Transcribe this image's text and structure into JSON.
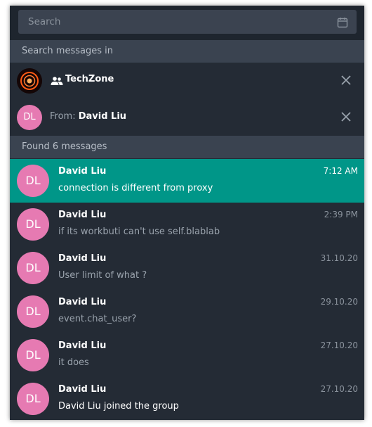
{
  "search": {
    "placeholder": "Search"
  },
  "scope": {
    "header": "Search messages in"
  },
  "chat_filter": {
    "title": "TechZone"
  },
  "from_filter": {
    "label": "From:",
    "name": "David Liu",
    "initials": "DL"
  },
  "results": {
    "header": "Found 6 messages",
    "items": [
      {
        "initials": "DL",
        "name": "David Liu",
        "text": "connection is different from proxy",
        "time": "7:12 AM"
      },
      {
        "initials": "DL",
        "name": "David Liu",
        "text": "if its workbuti can't use self.blablab",
        "time": "2:39 PM"
      },
      {
        "initials": "DL",
        "name": "David Liu",
        "text": "User limit of what ?",
        "time": "31.10.20"
      },
      {
        "initials": "DL",
        "name": "David Liu",
        "text": "event.chat_user?",
        "time": "29.10.20"
      },
      {
        "initials": "DL",
        "name": "David Liu",
        "text": "it does",
        "time": "27.10.20"
      },
      {
        "initials": "DL",
        "name": "David Liu",
        "text": "David Liu joined the group",
        "time": "27.10.20"
      }
    ]
  },
  "colors": {
    "panel_bg": "#242b35",
    "header_bg": "#3a4350",
    "active_row": "#009688",
    "avatar_pink": "#e67ab2"
  },
  "icons": {
    "calendar": "calendar-icon",
    "group": "group-icon",
    "close": "close-icon"
  }
}
